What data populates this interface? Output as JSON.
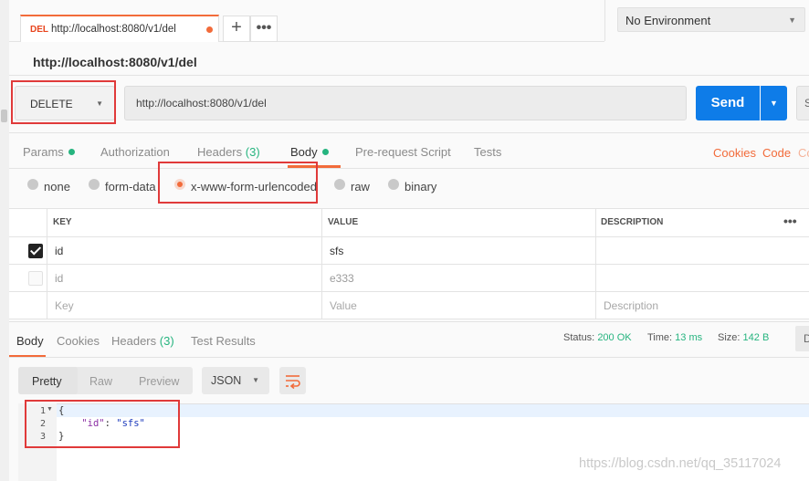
{
  "tab": {
    "method": "DEL",
    "url": "http://localhost:8080/v1/del",
    "add_icon": "+",
    "more_icon": "•••"
  },
  "environment": {
    "selected": "No Environment"
  },
  "request": {
    "title": "http://localhost:8080/v1/del",
    "method": "DELETE",
    "url": "http://localhost:8080/v1/del",
    "send_label": "Send",
    "save_label": "S"
  },
  "request_tabs": {
    "params": "Params",
    "authorization": "Authorization",
    "headers": "Headers",
    "headers_count": "(3)",
    "body": "Body",
    "prerequest": "Pre-request Script",
    "tests": "Tests",
    "cookies": "Cookies",
    "code": "Code",
    "comments": "Co"
  },
  "body_types": {
    "none": "none",
    "form_data": "form-data",
    "urlencoded": "x-www-form-urlencoded",
    "raw": "raw",
    "binary": "binary"
  },
  "params_table": {
    "headers": {
      "key": "KEY",
      "value": "VALUE",
      "description": "DESCRIPTION",
      "more": "•••"
    },
    "rows": [
      {
        "checked": true,
        "key": "id",
        "value": "sfs",
        "description": ""
      },
      {
        "checked": false,
        "key": "id",
        "value": "e333",
        "description": ""
      }
    ],
    "placeholder": {
      "key": "Key",
      "value": "Value",
      "description": "Description"
    }
  },
  "response": {
    "tabs": {
      "body": "Body",
      "cookies": "Cookies",
      "headers": "Headers",
      "headers_count": "(3)",
      "test_results": "Test Results"
    },
    "status_label": "Status:",
    "status_value": "200 OK",
    "time_label": "Time:",
    "time_value": "13 ms",
    "size_label": "Size:",
    "size_value": "142 B",
    "extra": "D",
    "formats": {
      "pretty": "Pretty",
      "raw": "Raw",
      "preview": "Preview"
    },
    "language": "JSON",
    "code_lines": [
      {
        "num": "1",
        "text": "{"
      },
      {
        "num": "2",
        "key": "\"id\"",
        "sep": ": ",
        "val": "\"sfs\""
      },
      {
        "num": "3",
        "text": "}"
      }
    ]
  },
  "watermark": "https://blog.csdn.net/qq_35117024",
  "colors": {
    "accent": "#f26b3a",
    "send": "#0e7ce8",
    "green": "#26b47f",
    "highlight": "#e03a3a"
  }
}
